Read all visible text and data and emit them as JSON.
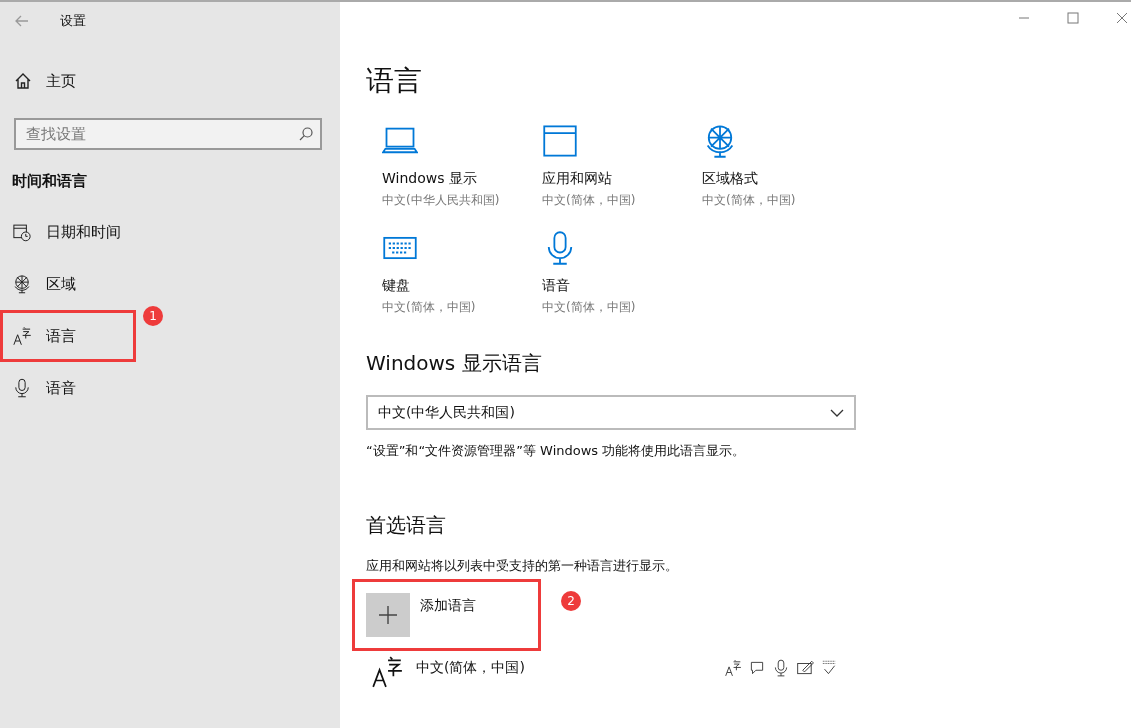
{
  "window": {
    "title": "设置"
  },
  "sidebar": {
    "home": "主页",
    "search": {
      "placeholder": "查找设置"
    },
    "section": "时间和语言",
    "items": [
      {
        "kind": "calendar",
        "label": "日期和时间"
      },
      {
        "kind": "globe",
        "label": "区域"
      },
      {
        "kind": "language",
        "label": "语言",
        "annotation": "1"
      },
      {
        "kind": "mic",
        "label": "语音"
      }
    ]
  },
  "main": {
    "heading": "语言",
    "tiles": [
      {
        "kind": "laptop",
        "title": "Windows 显示",
        "subtitle": "中文(中华人民共和国)"
      },
      {
        "kind": "window",
        "title": "应用和网站",
        "subtitle": "中文(简体，中国)"
      },
      {
        "kind": "globe",
        "title": "区域格式",
        "subtitle": "中文(简体，中国)"
      },
      {
        "kind": "keyboard",
        "title": "键盘",
        "subtitle": "中文(简体，中国)"
      },
      {
        "kind": "mic",
        "title": "语音",
        "subtitle": "中文(简体，中国)"
      }
    ],
    "display_language": {
      "heading": "Windows 显示语言",
      "value": "中文(中华人民共和国)",
      "note": "“设置”和“文件资源管理器”等 Windows 功能将使用此语言显示。"
    },
    "preferred": {
      "heading": "首选语言",
      "description": "应用和网站将以列表中受支持的第一种语言进行显示。",
      "add_button": {
        "label": "添加语言",
        "annotation": "2"
      },
      "languages": [
        {
          "name": "中文(简体，中国)",
          "features": [
            {
              "kind": "language"
            },
            {
              "kind": "speech-bubble"
            },
            {
              "kind": "mic"
            },
            {
              "kind": "handwriting"
            },
            {
              "kind": "spellcheck"
            }
          ]
        }
      ]
    }
  }
}
